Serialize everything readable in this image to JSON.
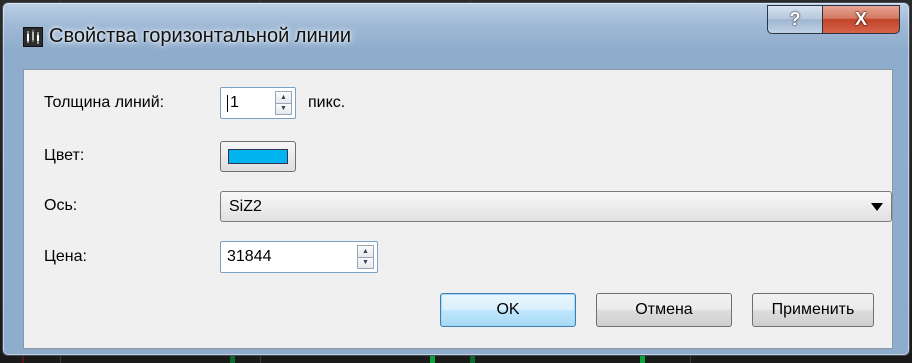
{
  "window": {
    "title": "Свойства горизонтальной линии",
    "icon": "chart-app-icon",
    "help_label": "?",
    "close_label": "X"
  },
  "form": {
    "thickness": {
      "label": "Толщина линий:",
      "value": "1",
      "unit": "пикс."
    },
    "color": {
      "label": "Цвет:",
      "value": "#00b4f0"
    },
    "axis": {
      "label": "Ось:",
      "value": "SiZ2"
    },
    "price": {
      "label": "Цена:",
      "value": "31844"
    }
  },
  "buttons": {
    "ok": "OK",
    "cancel": "Отмена",
    "apply": "Применить"
  }
}
